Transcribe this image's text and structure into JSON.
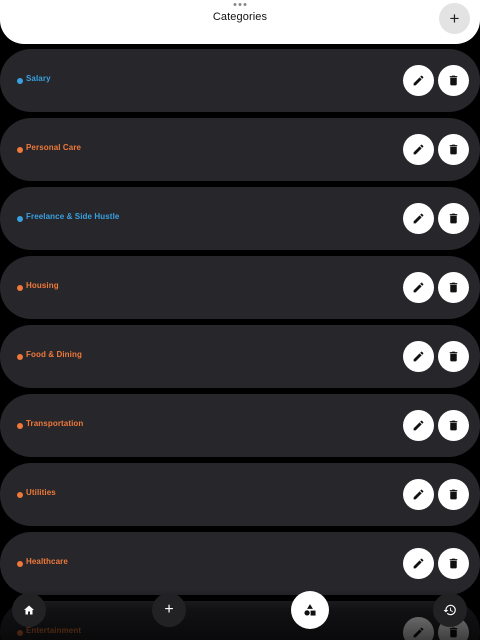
{
  "header": {
    "title": "Categories",
    "add_button_label": "+"
  },
  "categories": [
    {
      "label": "Salary",
      "color": "#3aa1e0"
    },
    {
      "label": "Personal Care",
      "color": "#f0793a"
    },
    {
      "label": "Freelance & Side Hustle",
      "color": "#3aa1e0"
    },
    {
      "label": "Housing",
      "color": "#f0793a"
    },
    {
      "label": "Food & Dining",
      "color": "#f0793a"
    },
    {
      "label": "Transportation",
      "color": "#f0793a"
    },
    {
      "label": "Utilities",
      "color": "#f0793a"
    },
    {
      "label": "Healthcare",
      "color": "#f0793a"
    },
    {
      "label": "Entertainment",
      "color": "#f0793a"
    }
  ],
  "icons": {
    "edit": "pencil-icon",
    "delete": "trash-icon"
  },
  "bottom_nav": {
    "items": [
      {
        "name": "home",
        "icon": "home-icon"
      },
      {
        "name": "add",
        "icon": "plus-icon",
        "label": "+"
      },
      {
        "name": "categories",
        "icon": "shapes-icon",
        "active": true
      },
      {
        "name": "history",
        "icon": "history-icon"
      }
    ]
  },
  "colors": {
    "income": "#3aa1e0",
    "expense": "#f0793a",
    "row_bg": "#26262b",
    "background": "#000000"
  }
}
